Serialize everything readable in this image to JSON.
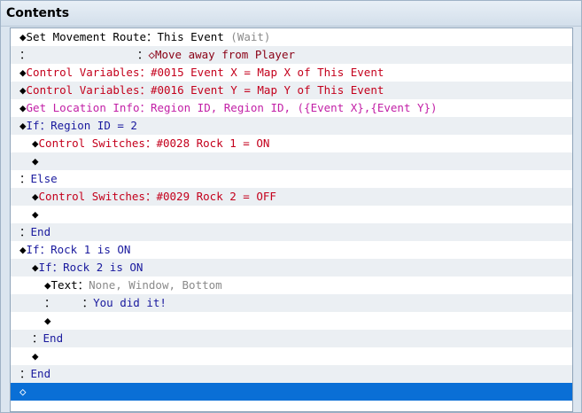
{
  "header": {
    "title": "Contents"
  },
  "colors": {
    "navy": "#1a1a9e",
    "red": "#c4001c",
    "magenta": "#c21fa6",
    "gray": "#8a8a8a",
    "selection": "#0a6fd6"
  },
  "rows": [
    {
      "indent": 0,
      "prefix": "◆",
      "parts": [
        [
          "Set Movement Route",
          "black"
        ],
        [
          "：",
          "black"
        ],
        [
          "This Event",
          "black"
        ],
        [
          " (Wait)",
          "gray"
        ]
      ]
    },
    {
      "indent": 0,
      "prefix": "：",
      "parts": [
        [
          "                ：",
          "black"
        ],
        [
          "◇Move away from Player",
          "darkred"
        ]
      ]
    },
    {
      "indent": 0,
      "prefix": "◆",
      "parts": [
        [
          "Control Variables",
          "red"
        ],
        [
          "：",
          "red"
        ],
        [
          "#0015 Event X = Map X of This Event",
          "red"
        ]
      ]
    },
    {
      "indent": 0,
      "prefix": "◆",
      "parts": [
        [
          "Control Variables",
          "red"
        ],
        [
          "：",
          "red"
        ],
        [
          "#0016 Event Y = Map Y of This Event",
          "red"
        ]
      ]
    },
    {
      "indent": 0,
      "prefix": "◆",
      "parts": [
        [
          "Get Location Info",
          "magenta"
        ],
        [
          "：",
          "magenta"
        ],
        [
          "Region ID, Region ID, ({Event X},{Event Y})",
          "magenta"
        ]
      ]
    },
    {
      "indent": 0,
      "prefix": "◆",
      "parts": [
        [
          "If",
          "navy"
        ],
        [
          "：",
          "navy"
        ],
        [
          "Region ID = 2",
          "navy"
        ]
      ]
    },
    {
      "indent": 1,
      "prefix": "◆",
      "parts": [
        [
          "Control Switches",
          "red"
        ],
        [
          "：",
          "red"
        ],
        [
          "#0028 Rock 1 = ON",
          "red"
        ]
      ]
    },
    {
      "indent": 1,
      "prefix": "◆",
      "parts": []
    },
    {
      "indent": 0,
      "prefix": "：",
      "parts": [
        [
          "Else",
          "navy"
        ]
      ]
    },
    {
      "indent": 1,
      "prefix": "◆",
      "parts": [
        [
          "Control Switches",
          "red"
        ],
        [
          "：",
          "red"
        ],
        [
          "#0029 Rock 2 = OFF",
          "red"
        ]
      ]
    },
    {
      "indent": 1,
      "prefix": "◆",
      "parts": []
    },
    {
      "indent": 0,
      "prefix": "：",
      "parts": [
        [
          "End",
          "navy"
        ]
      ]
    },
    {
      "indent": 0,
      "prefix": "◆",
      "parts": [
        [
          "If",
          "navy"
        ],
        [
          "：",
          "navy"
        ],
        [
          "Rock 1 is ON",
          "navy"
        ]
      ]
    },
    {
      "indent": 1,
      "prefix": "◆",
      "parts": [
        [
          "If",
          "navy"
        ],
        [
          "：",
          "navy"
        ],
        [
          "Rock 2 is ON",
          "navy"
        ]
      ]
    },
    {
      "indent": 2,
      "prefix": "◆",
      "parts": [
        [
          "Text",
          "black"
        ],
        [
          "：",
          "black"
        ],
        [
          "None, Window, Bottom",
          "gray"
        ]
      ]
    },
    {
      "indent": 2,
      "prefix": "：",
      "parts": [
        [
          "    ：",
          "black"
        ],
        [
          "You did it!",
          "navy"
        ]
      ]
    },
    {
      "indent": 2,
      "prefix": "◆",
      "parts": []
    },
    {
      "indent": 1,
      "prefix": "：",
      "parts": [
        [
          "End",
          "navy"
        ]
      ]
    },
    {
      "indent": 1,
      "prefix": "◆",
      "parts": []
    },
    {
      "indent": 0,
      "prefix": "：",
      "parts": [
        [
          "End",
          "navy"
        ]
      ]
    },
    {
      "indent": 0,
      "prefix": "◆",
      "parts": [],
      "selected": true
    }
  ]
}
